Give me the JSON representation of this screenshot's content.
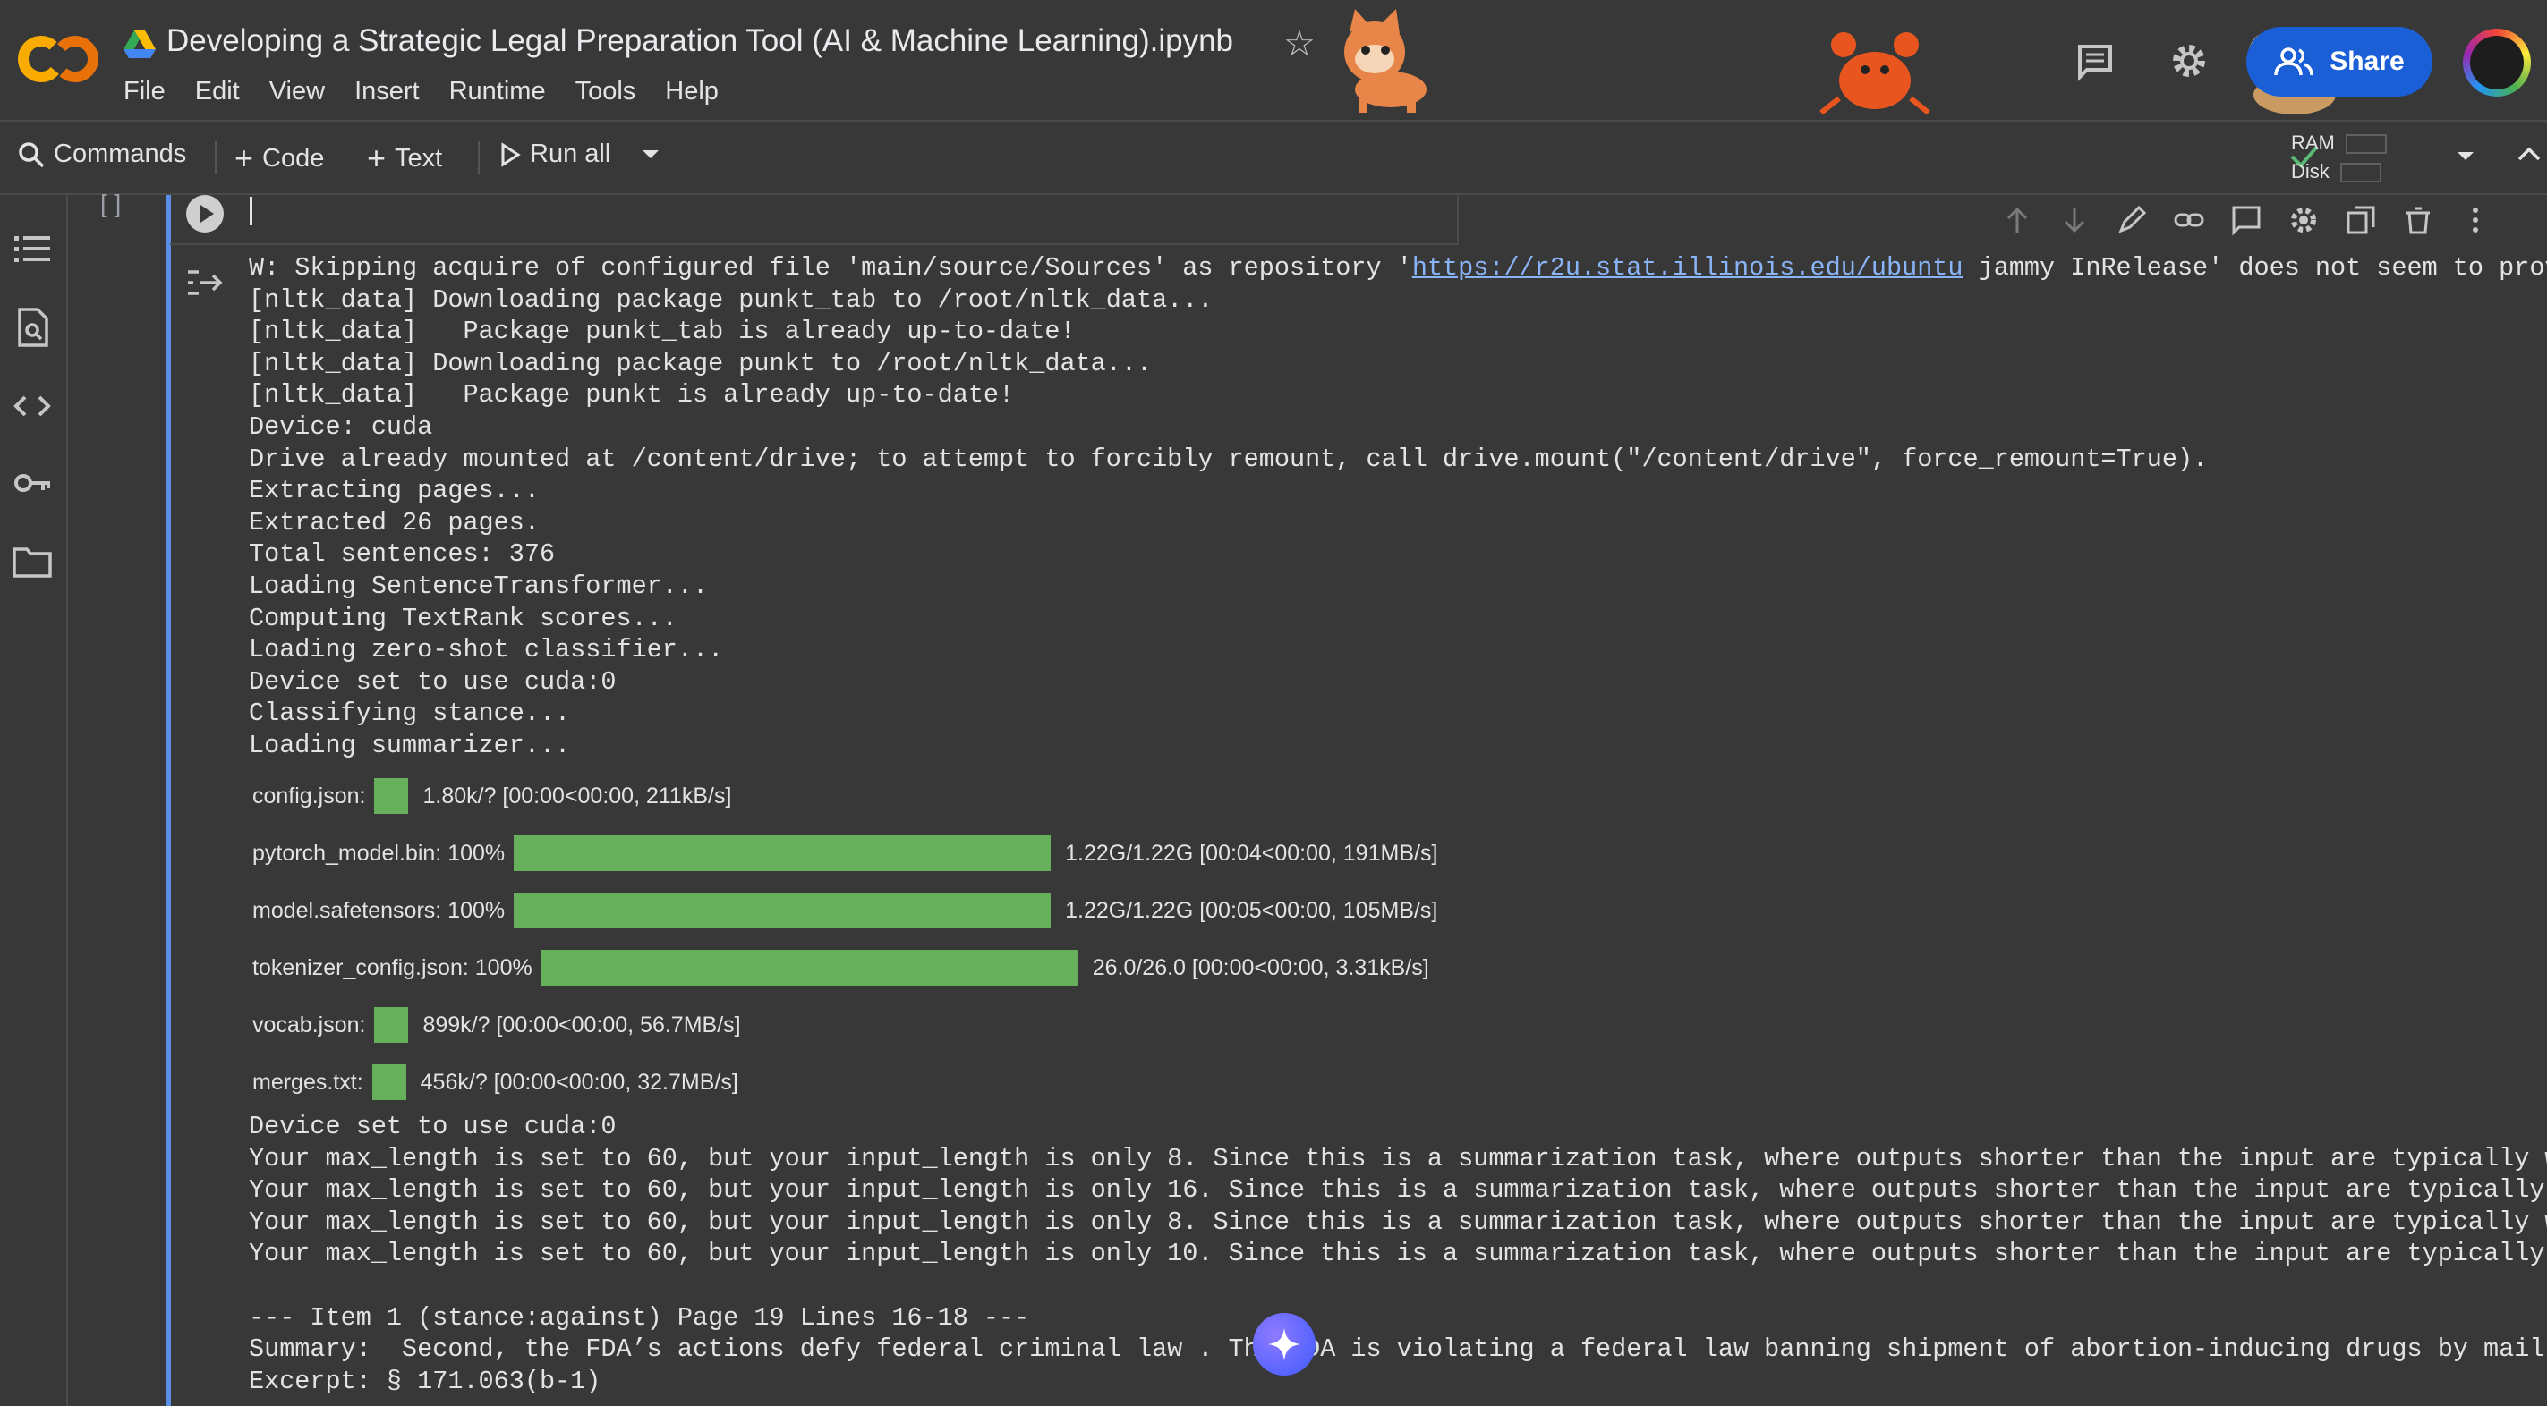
{
  "header": {
    "title": "Developing a Strategic Legal Preparation Tool (AI & Machine Learning).ipynb",
    "logo_text": "CO",
    "menu": [
      "File",
      "Edit",
      "View",
      "Insert",
      "Runtime",
      "Tools",
      "Help"
    ],
    "share_label": "Share"
  },
  "toolbar": {
    "commands_label": "Commands",
    "code_label": "Code",
    "text_label": "Text",
    "run_all_label": "Run all",
    "ram_label": "RAM",
    "disk_label": "Disk"
  },
  "cell": {
    "bracket": "[ ]"
  },
  "output": {
    "warning_prefix": "W: Skipping acquire of configured file 'main/source/Sources' as repository '",
    "warning_link": "https://r2u.stat.illinois.edu/ubuntu",
    "warning_suffix": " jammy InRelease' does not seem to prov",
    "lines": [
      "[nltk_data] Downloading package punkt_tab to /root/nltk_data...",
      "[nltk_data]   Package punkt_tab is already up-to-date!",
      "[nltk_data] Downloading package punkt to /root/nltk_data...",
      "[nltk_data]   Package punkt is already up-to-date!",
      "Device: cuda",
      "Drive already mounted at /content/drive; to attempt to forcibly remount, call drive.mount(\"/content/drive\", force_remount=True).",
      "Extracting pages...",
      "Extracted 26 pages.",
      "Total sentences: 376",
      "Loading SentenceTransformer...",
      "Computing TextRank scores...",
      "Loading zero-shot classifier...",
      "Device set to use cuda:0",
      "Classifying stance...",
      "Loading summarizer..."
    ],
    "progress": [
      {
        "label": "config.json:",
        "fill_fraction": 0.0,
        "stat": "1.80k/? [00:00<00:00, 211kB/s]"
      },
      {
        "label": "pytorch_model.bin: 100%",
        "fill_fraction": 1.0,
        "stat": "1.22G/1.22G [00:04<00:00, 191MB/s]"
      },
      {
        "label": "model.safetensors: 100%",
        "fill_fraction": 1.0,
        "stat": "1.22G/1.22G [00:05<00:00, 105MB/s]"
      },
      {
        "label": "tokenizer_config.json: 100%",
        "fill_fraction": 1.0,
        "stat": "26.0/26.0 [00:00<00:00, 3.31kB/s]"
      },
      {
        "label": "vocab.json:",
        "fill_fraction": 0.0,
        "stat": "899k/? [00:00<00:00, 56.7MB/s]"
      },
      {
        "label": "merges.txt:",
        "fill_fraction": 0.0,
        "stat": "456k/? [00:00<00:00, 32.7MB/s]"
      }
    ],
    "lines2": [
      "Device set to use cuda:0",
      "Your max_length is set to 60, but your input_length is only 8. Since this is a summarization task, where outputs shorter than the input are typically w",
      "Your max_length is set to 60, but your input_length is only 16. Since this is a summarization task, where outputs shorter than the input are typically",
      "Your max_length is set to 60, but your input_length is only 8. Since this is a summarization task, where outputs shorter than the input are typically w",
      "Your max_length is set to 60, but your input_length is only 10. Since this is a summarization task, where outputs shorter than the input are typically",
      "",
      "--- Item 1 (stance:against) Page 19 Lines 16-18 ---",
      "Summary:  Second, the FDA’s actions defy federal criminal law . The FDA is violating a federal law banning shipment of abortion-inducing drugs by mail",
      "Excerpt: § 171.063(b-1)"
    ]
  },
  "colors": {
    "background": "#383838",
    "accent_blue": "#1a5fd6",
    "progress_green": "#66b05b",
    "link": "#8ab4f8",
    "cell_border": "#5b8de6"
  },
  "icons": {
    "sidebar": [
      "toc-icon",
      "find-icon",
      "code-snippets-icon",
      "secrets-key-icon",
      "files-folder-icon"
    ],
    "cell_toolbar": [
      "move-up-icon",
      "move-down-icon",
      "edit-icon",
      "link-icon",
      "comment-icon",
      "settings-icon",
      "mirror-cell-icon",
      "delete-icon",
      "more-icon"
    ]
  }
}
